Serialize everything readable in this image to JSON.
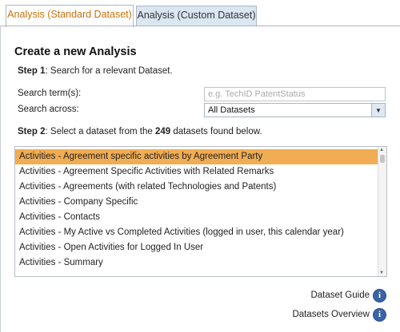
{
  "tabs": [
    {
      "label": "Analysis (Standard Dataset)",
      "active": true
    },
    {
      "label": "Analysis (Custom Dataset)",
      "active": false
    }
  ],
  "heading": "Create a new Analysis",
  "step1": {
    "prefix": "Step 1",
    "text": ": Search for a relevant Dataset."
  },
  "search": {
    "label": "Search term(s):",
    "placeholder": "e.g. TechID PatentStatus",
    "value": ""
  },
  "search_across": {
    "label": "Search across:",
    "selected": "All Datasets"
  },
  "step2": {
    "prefix": "Step 2",
    "text_before": ": Select a dataset from the ",
    "count": "249",
    "text_after": " datasets found below."
  },
  "datasets": [
    "Activities - Agreement specific activities by Agreement Party",
    "Activities - Agreement Specific Activities with Related Remarks",
    "Activities - Agreements (with related Technologies and Patents)",
    "Activities - Company Specific",
    "Activities - Contacts",
    "Activities - My Active vs Completed Activities (logged in user, this calendar year)",
    "Activities - Open Activities for Logged In User",
    "Activities - Summary"
  ],
  "selected_index": 0,
  "links": {
    "dataset_guide": "Dataset Guide",
    "datasets_overview": "Datasets Overview"
  },
  "colors": {
    "active_tab_text": "#c9730a",
    "selected_row": "#f1ad53",
    "info_icon": "#3a63a8",
    "inactive_tab_bg": "#dbe6f3"
  }
}
